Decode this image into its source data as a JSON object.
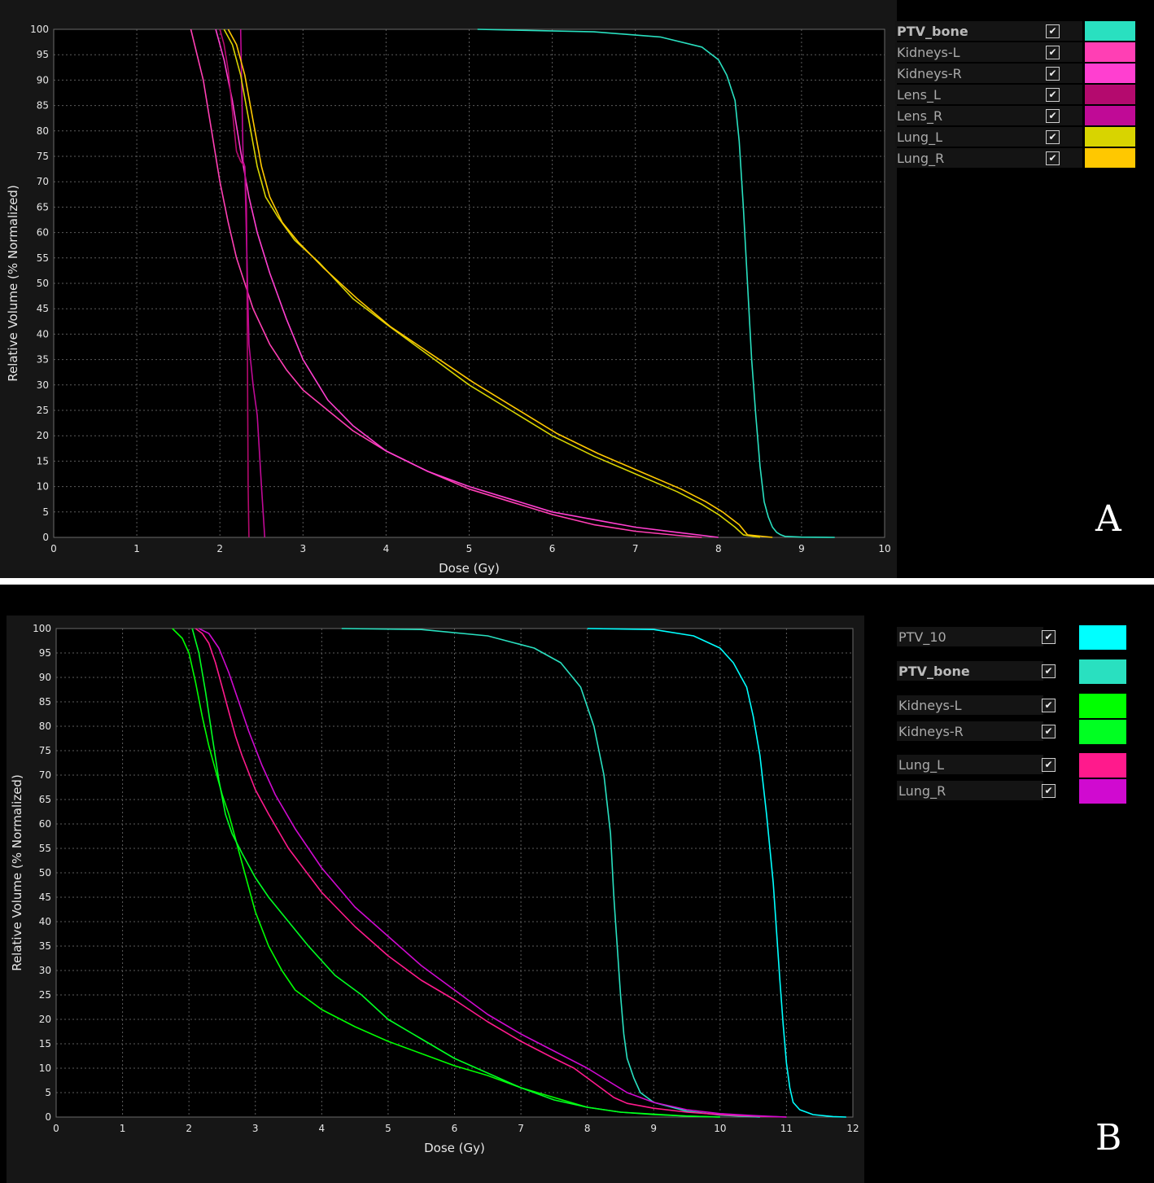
{
  "panels": [
    {
      "letter": "A",
      "legend": {
        "items": [
          {
            "name": "PTV_bone",
            "bold": true,
            "checked": true,
            "color": "#29e0c0"
          },
          {
            "name": "Kidneys-L",
            "checked": true,
            "color": "#ff3fb4"
          },
          {
            "name": "Kidneys-R",
            "checked": true,
            "color": "#ff3fd0"
          },
          {
            "name": "Lens_L",
            "checked": true,
            "color": "#b40a6e"
          },
          {
            "name": "Lens_R",
            "checked": true,
            "color": "#c00a96"
          },
          {
            "name": "Lung_L",
            "checked": true,
            "color": "#d8d400"
          },
          {
            "name": "Lung_R",
            "checked": true,
            "color": "#ffc800"
          }
        ]
      }
    },
    {
      "letter": "B",
      "legend": {
        "items": [
          {
            "name": "PTV_10",
            "checked": true,
            "color": "#00ffff"
          },
          {
            "name": "PTV_bone",
            "bold": true,
            "checked": true,
            "color": "#29e0c0"
          },
          {
            "name": "Kidneys-L",
            "checked": true,
            "color": "#00ff00"
          },
          {
            "name": "Kidneys-R",
            "checked": true,
            "color": "#00ff22"
          },
          {
            "name": "Lung_L",
            "checked": true,
            "color": "#ff1a8c"
          },
          {
            "name": "Lung_R",
            "checked": true,
            "color": "#d00ad0"
          }
        ]
      }
    }
  ],
  "chart_data": [
    {
      "type": "line",
      "xlabel": "Dose (Gy)",
      "ylabel": "Relative Volume (% Normalized)",
      "xlim": [
        0,
        10
      ],
      "ylim": [
        0,
        100
      ],
      "xticks": [
        "0",
        "1",
        "2",
        "3",
        "4",
        "5",
        "6",
        "7",
        "8",
        "9",
        "10"
      ],
      "yticks": [
        "0",
        "5",
        "10",
        "15",
        "20",
        "25",
        "30",
        "35",
        "40",
        "45",
        "50",
        "55",
        "60",
        "65",
        "70",
        "75",
        "80",
        "85",
        "90",
        "95",
        "100"
      ],
      "grid": true,
      "series": [
        {
          "name": "PTV_bone",
          "color": "#29e0c0",
          "x": [
            5.1,
            6.5,
            7.3,
            7.8,
            8.0,
            8.1,
            8.2,
            8.25,
            8.3,
            8.35,
            8.4,
            8.45,
            8.5,
            8.55,
            8.6,
            8.65,
            8.7,
            8.75,
            8.8,
            9.0,
            9.4
          ],
          "y": [
            100,
            99.5,
            98.5,
            96.5,
            94,
            91,
            86,
            78,
            65,
            50,
            35,
            24,
            14,
            7,
            4,
            2,
            1,
            0.5,
            0.2,
            0.05,
            0
          ]
        },
        {
          "name": "Kidneys-L",
          "color": "#ff3fb4",
          "x": [
            1.65,
            1.8,
            1.9,
            2.0,
            2.1,
            2.2,
            2.3,
            2.4,
            2.6,
            2.8,
            3.0,
            3.3,
            3.6,
            4.0,
            4.5,
            5.0,
            5.5,
            6.0,
            6.5,
            7.0,
            7.5,
            7.8
          ],
          "y": [
            100,
            90,
            80,
            70,
            62,
            55,
            50,
            45,
            38,
            33,
            29,
            25,
            21,
            17,
            13,
            9.5,
            7,
            4.5,
            2.5,
            1.2,
            0.4,
            0
          ]
        },
        {
          "name": "Kidneys-R",
          "color": "#ff3fd0",
          "x": [
            1.95,
            2.05,
            2.15,
            2.25,
            2.35,
            2.45,
            2.6,
            2.8,
            3.0,
            3.3,
            3.6,
            4.0,
            4.5,
            5.0,
            5.5,
            6.0,
            6.5,
            7.0,
            7.5,
            8.0
          ],
          "y": [
            100,
            94,
            86,
            76,
            67,
            60,
            52,
            43,
            35,
            27,
            22,
            17,
            13,
            10,
            7.5,
            5,
            3.5,
            2,
            1,
            0
          ]
        },
        {
          "name": "Lens_L",
          "color": "#b40a6e",
          "x": [
            2.0,
            2.05,
            2.1,
            2.15,
            2.2,
            2.25,
            2.3,
            2.32,
            2.33,
            2.34,
            2.35
          ],
          "y": [
            100,
            97,
            92,
            84,
            76,
            74,
            73,
            65,
            40,
            10,
            0
          ]
        },
        {
          "name": "Lens_R",
          "color": "#c00a96",
          "x": [
            2.25,
            2.28,
            2.3,
            2.35,
            2.4,
            2.45,
            2.5,
            2.52,
            2.54
          ],
          "y": [
            100,
            74,
            73,
            38,
            30,
            24,
            10,
            5,
            0
          ]
        },
        {
          "name": "Lung_L",
          "color": "#d8d400",
          "x": [
            2.05,
            2.15,
            2.25,
            2.35,
            2.45,
            2.55,
            2.7,
            2.9,
            3.2,
            3.6,
            4.0,
            4.5,
            5.0,
            5.5,
            6.0,
            6.5,
            7.0,
            7.5,
            7.8,
            8.0,
            8.2,
            8.3,
            8.5
          ],
          "y": [
            100,
            97,
            91,
            82,
            73,
            67,
            63,
            58.5,
            54,
            47,
            42,
            36,
            30,
            25,
            20,
            16,
            12.5,
            9,
            6.5,
            4.5,
            2,
            0.5,
            0
          ]
        },
        {
          "name": "Lung_R",
          "color": "#ffc800",
          "x": [
            2.1,
            2.2,
            2.3,
            2.4,
            2.5,
            2.6,
            2.75,
            2.95,
            3.25,
            3.65,
            4.05,
            4.55,
            5.05,
            5.55,
            6.05,
            6.55,
            7.05,
            7.55,
            7.85,
            8.05,
            8.25,
            8.35,
            8.65
          ],
          "y": [
            100,
            97,
            91,
            82,
            73,
            67,
            62,
            58,
            53,
            47,
            41.5,
            36,
            30.5,
            25.5,
            20.5,
            16.5,
            13,
            9.5,
            7,
            5,
            2.5,
            0.5,
            0
          ]
        }
      ]
    },
    {
      "type": "line",
      "xlabel": "Dose (Gy)",
      "ylabel": "Relative Volume (% Normalized)",
      "xlim": [
        0,
        12
      ],
      "ylim": [
        0,
        100
      ],
      "xticks": [
        "0",
        "1",
        "2",
        "3",
        "4",
        "5",
        "6",
        "7",
        "8",
        "9",
        "10",
        "11",
        "12"
      ],
      "yticks": [
        "0",
        "5",
        "10",
        "15",
        "20",
        "25",
        "30",
        "35",
        "40",
        "45",
        "50",
        "55",
        "60",
        "65",
        "70",
        "75",
        "80",
        "85",
        "90",
        "95",
        "100"
      ],
      "grid": true,
      "series": [
        {
          "name": "PTV_10",
          "color": "#00ffff",
          "x": [
            8.0,
            9.0,
            9.6,
            10.0,
            10.2,
            10.4,
            10.5,
            10.6,
            10.7,
            10.8,
            10.85,
            10.9,
            10.95,
            11.0,
            11.05,
            11.1,
            11.2,
            11.4,
            11.7,
            11.9
          ],
          "y": [
            100,
            99.8,
            98.5,
            96,
            93,
            88,
            82,
            74,
            62,
            48,
            38,
            28,
            19,
            11,
            6,
            3,
            1.5,
            0.5,
            0.1,
            0
          ]
        },
        {
          "name": "PTV_bone",
          "color": "#29e0c0",
          "x": [
            4.3,
            5.5,
            6.5,
            7.2,
            7.6,
            7.9,
            8.1,
            8.25,
            8.35,
            8.4,
            8.45,
            8.5,
            8.55,
            8.6,
            8.7,
            8.8,
            9.0,
            9.5,
            10.0,
            10.6
          ],
          "y": [
            100,
            99.8,
            98.5,
            96,
            93,
            88,
            80,
            70,
            58,
            45,
            35,
            25,
            17,
            12,
            8,
            5,
            3,
            1.2,
            0.4,
            0
          ]
        },
        {
          "name": "Kidneys-L",
          "color": "#00ff00",
          "x": [
            1.75,
            1.9,
            2.0,
            2.1,
            2.2,
            2.3,
            2.4,
            2.5,
            2.6,
            2.7,
            2.8,
            2.9,
            3.0,
            3.2,
            3.4,
            3.6,
            4.0,
            4.5,
            5.0,
            5.5,
            6.0,
            6.5,
            7.0,
            7.5,
            8.0,
            8.5,
            9.0,
            9.5,
            10.0
          ],
          "y": [
            100,
            98,
            95,
            89,
            82,
            76,
            71,
            66,
            62,
            57,
            52,
            47,
            42,
            35,
            30,
            26,
            22,
            18.5,
            15.5,
            13,
            10.5,
            8.5,
            6,
            4,
            2,
            1,
            0.6,
            0.2,
            0
          ]
        },
        {
          "name": "Kidneys-R",
          "color": "#00ff22",
          "x": [
            2.05,
            2.15,
            2.25,
            2.35,
            2.45,
            2.55,
            2.65,
            2.8,
            3.0,
            3.2,
            3.5,
            3.8,
            4.2,
            4.6,
            5.0,
            5.5,
            6.0,
            6.5,
            7.0,
            7.5,
            8.0,
            8.5,
            9.0,
            9.5,
            10.0
          ],
          "y": [
            100,
            95,
            87,
            78,
            69,
            62,
            58,
            54,
            49,
            45,
            40,
            35,
            29,
            25,
            20,
            16,
            12,
            9,
            6,
            3.5,
            2,
            1,
            0.5,
            0.2,
            0
          ]
        },
        {
          "name": "Lung_L",
          "color": "#ff1a8c",
          "x": [
            2.1,
            2.2,
            2.3,
            2.4,
            2.5,
            2.6,
            2.7,
            2.8,
            3.0,
            3.2,
            3.5,
            4.0,
            4.5,
            5.0,
            5.5,
            6.0,
            6.5,
            7.0,
            7.5,
            7.8,
            8.0,
            8.2,
            8.4,
            8.6,
            9.0,
            9.5,
            10.0,
            10.5,
            11.0
          ],
          "y": [
            100,
            99,
            97,
            93,
            88,
            83,
            78,
            74,
            67,
            62,
            55,
            46,
            39,
            33,
            28,
            24,
            19.5,
            15.5,
            12,
            10,
            8,
            6,
            4,
            2.8,
            1.8,
            1,
            0.5,
            0.2,
            0
          ]
        },
        {
          "name": "Lung_R",
          "color": "#d00ad0",
          "x": [
            2.15,
            2.3,
            2.45,
            2.6,
            2.75,
            2.9,
            3.1,
            3.3,
            3.6,
            4.0,
            4.5,
            5.0,
            5.5,
            6.0,
            6.5,
            7.0,
            7.5,
            8.0,
            8.3,
            8.6,
            9.0,
            9.5,
            10.0,
            10.5,
            11.0
          ],
          "y": [
            100,
            99,
            96,
            91,
            85,
            79,
            72,
            66,
            59,
            51,
            43,
            37,
            31,
            26,
            21,
            17,
            13.5,
            10,
            7.5,
            5,
            3,
            1.5,
            0.7,
            0.3,
            0
          ]
        }
      ]
    }
  ]
}
